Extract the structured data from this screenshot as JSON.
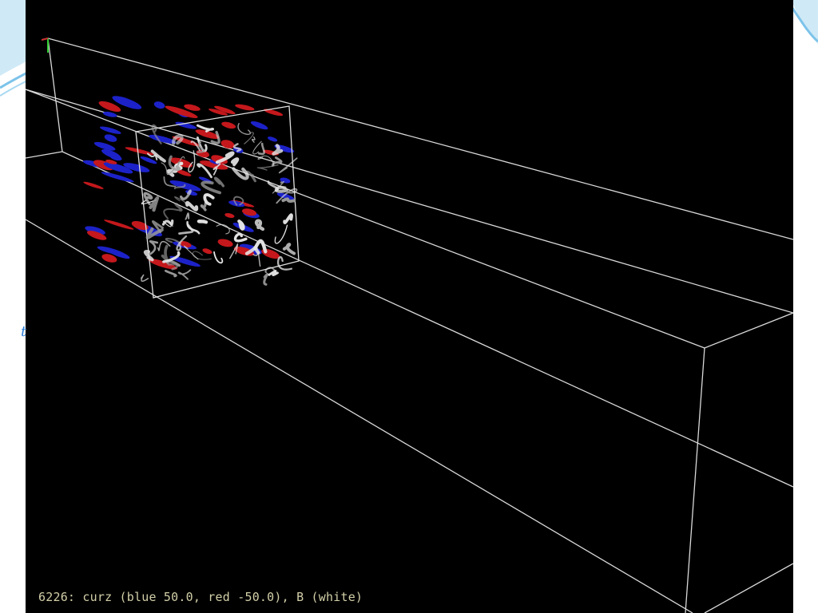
{
  "viewer": {
    "caption": "6226: curz (blue 50.0, red -50.0), B (white)",
    "colors": {
      "background": "#000000",
      "frame_lines": "#d9d9d9",
      "positive_current": "#1c22c8",
      "negative_current": "#c4181c",
      "field_lines": "#e6e6e6",
      "caption_text": "#d2cfa8"
    },
    "legend": {
      "variable": "curz",
      "blue_value": 50.0,
      "red_value": -50.0,
      "white_variable": "B"
    }
  },
  "slide": {
    "accent_color": "#2c7fd6"
  }
}
